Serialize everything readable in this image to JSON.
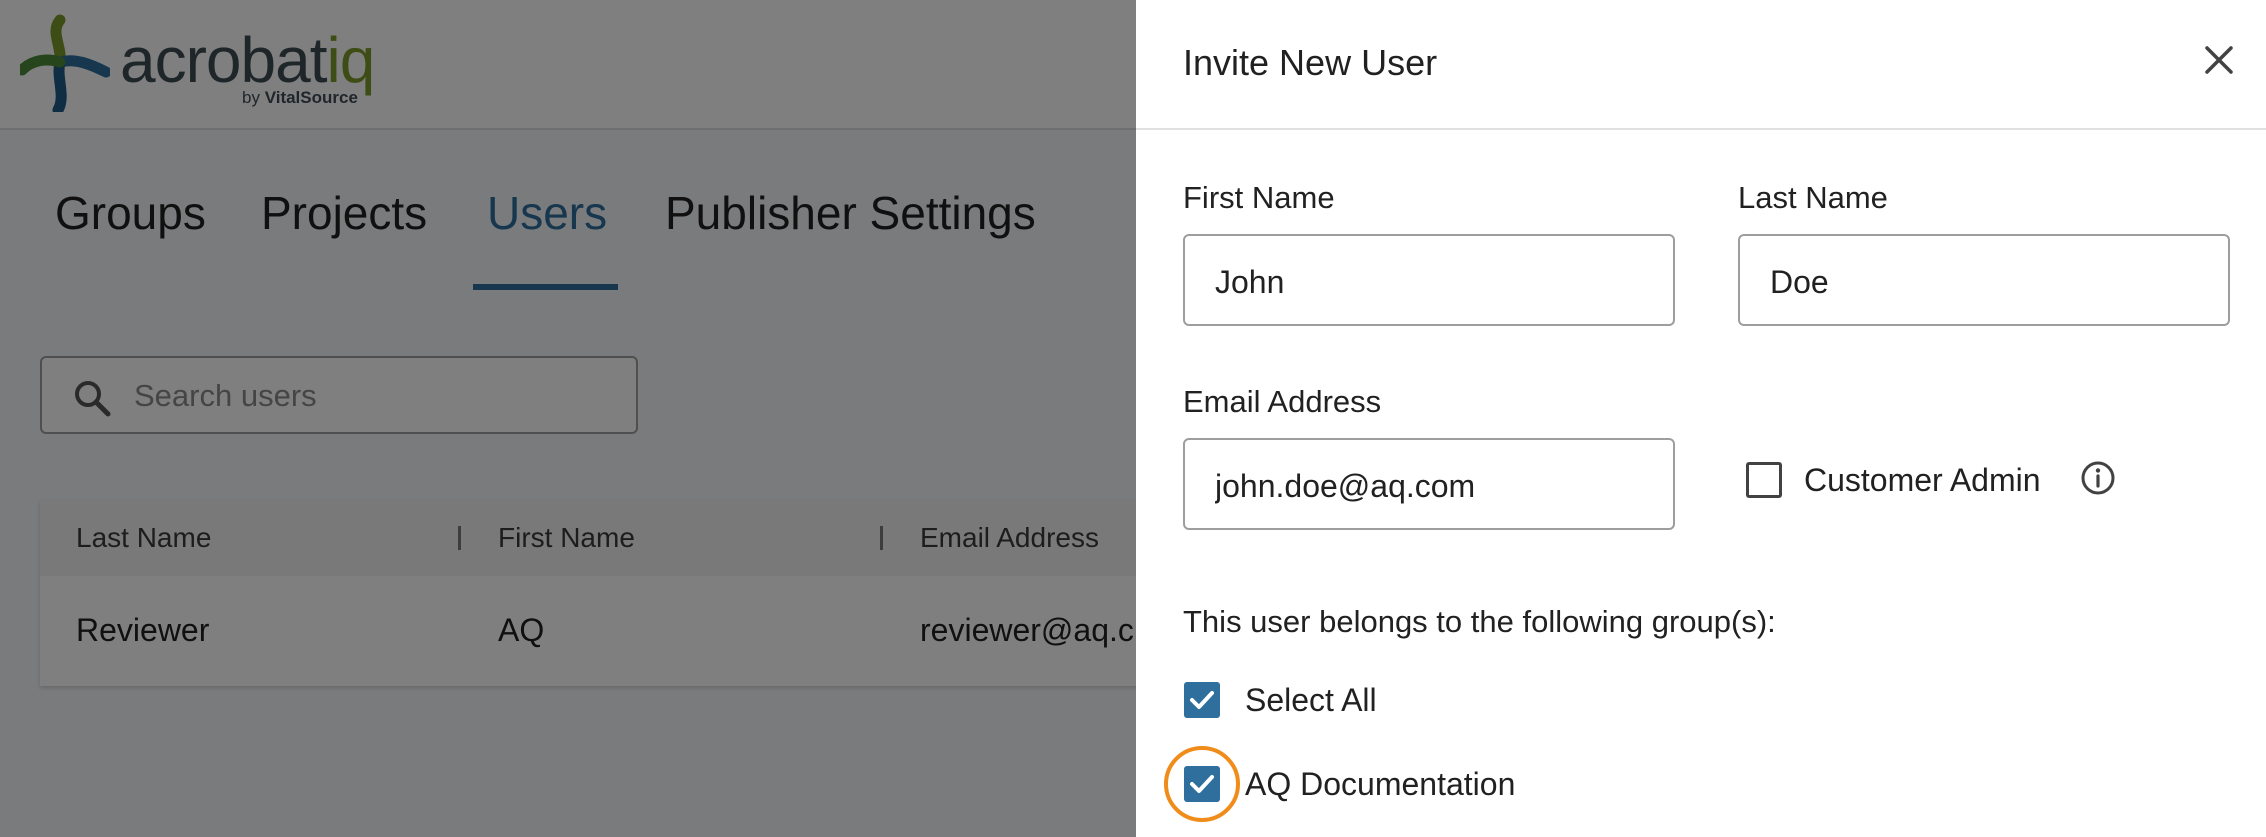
{
  "app": {
    "logo": {
      "word_main": "acrobat",
      "word_accent": "iq",
      "sub_prefix": "by ",
      "sub_brand": "VitalSource"
    },
    "tabs": [
      {
        "label": "Groups"
      },
      {
        "label": "Projects"
      },
      {
        "label": "Users"
      },
      {
        "label": "Publisher Settings"
      }
    ],
    "search": {
      "placeholder": "Search users",
      "value": ""
    },
    "table": {
      "columns": [
        "Last Name",
        "First Name",
        "Email Address"
      ],
      "rows": [
        {
          "last_name": "Reviewer",
          "first_name": "AQ",
          "email": "reviewer@aq.c"
        }
      ]
    }
  },
  "drawer": {
    "title": "Invite New User",
    "first_name": {
      "label": "First Name",
      "value": "John"
    },
    "last_name": {
      "label": "Last Name",
      "value": "Doe"
    },
    "email": {
      "label": "Email Address",
      "value": "john.doe@aq.com"
    },
    "customer_admin": {
      "label": "Customer Admin",
      "checked": false
    },
    "groups": {
      "heading": "This user belongs to the following group(s):",
      "select_all": {
        "label": "Select All",
        "checked": true
      },
      "items": [
        {
          "label": "AQ Documentation",
          "checked": true
        }
      ]
    }
  },
  "colors": {
    "accent": "#2e6f9e",
    "focus_ring": "#f08c1a",
    "logo_green": "#7a9a2a",
    "logo_dark": "#3f4c55"
  }
}
